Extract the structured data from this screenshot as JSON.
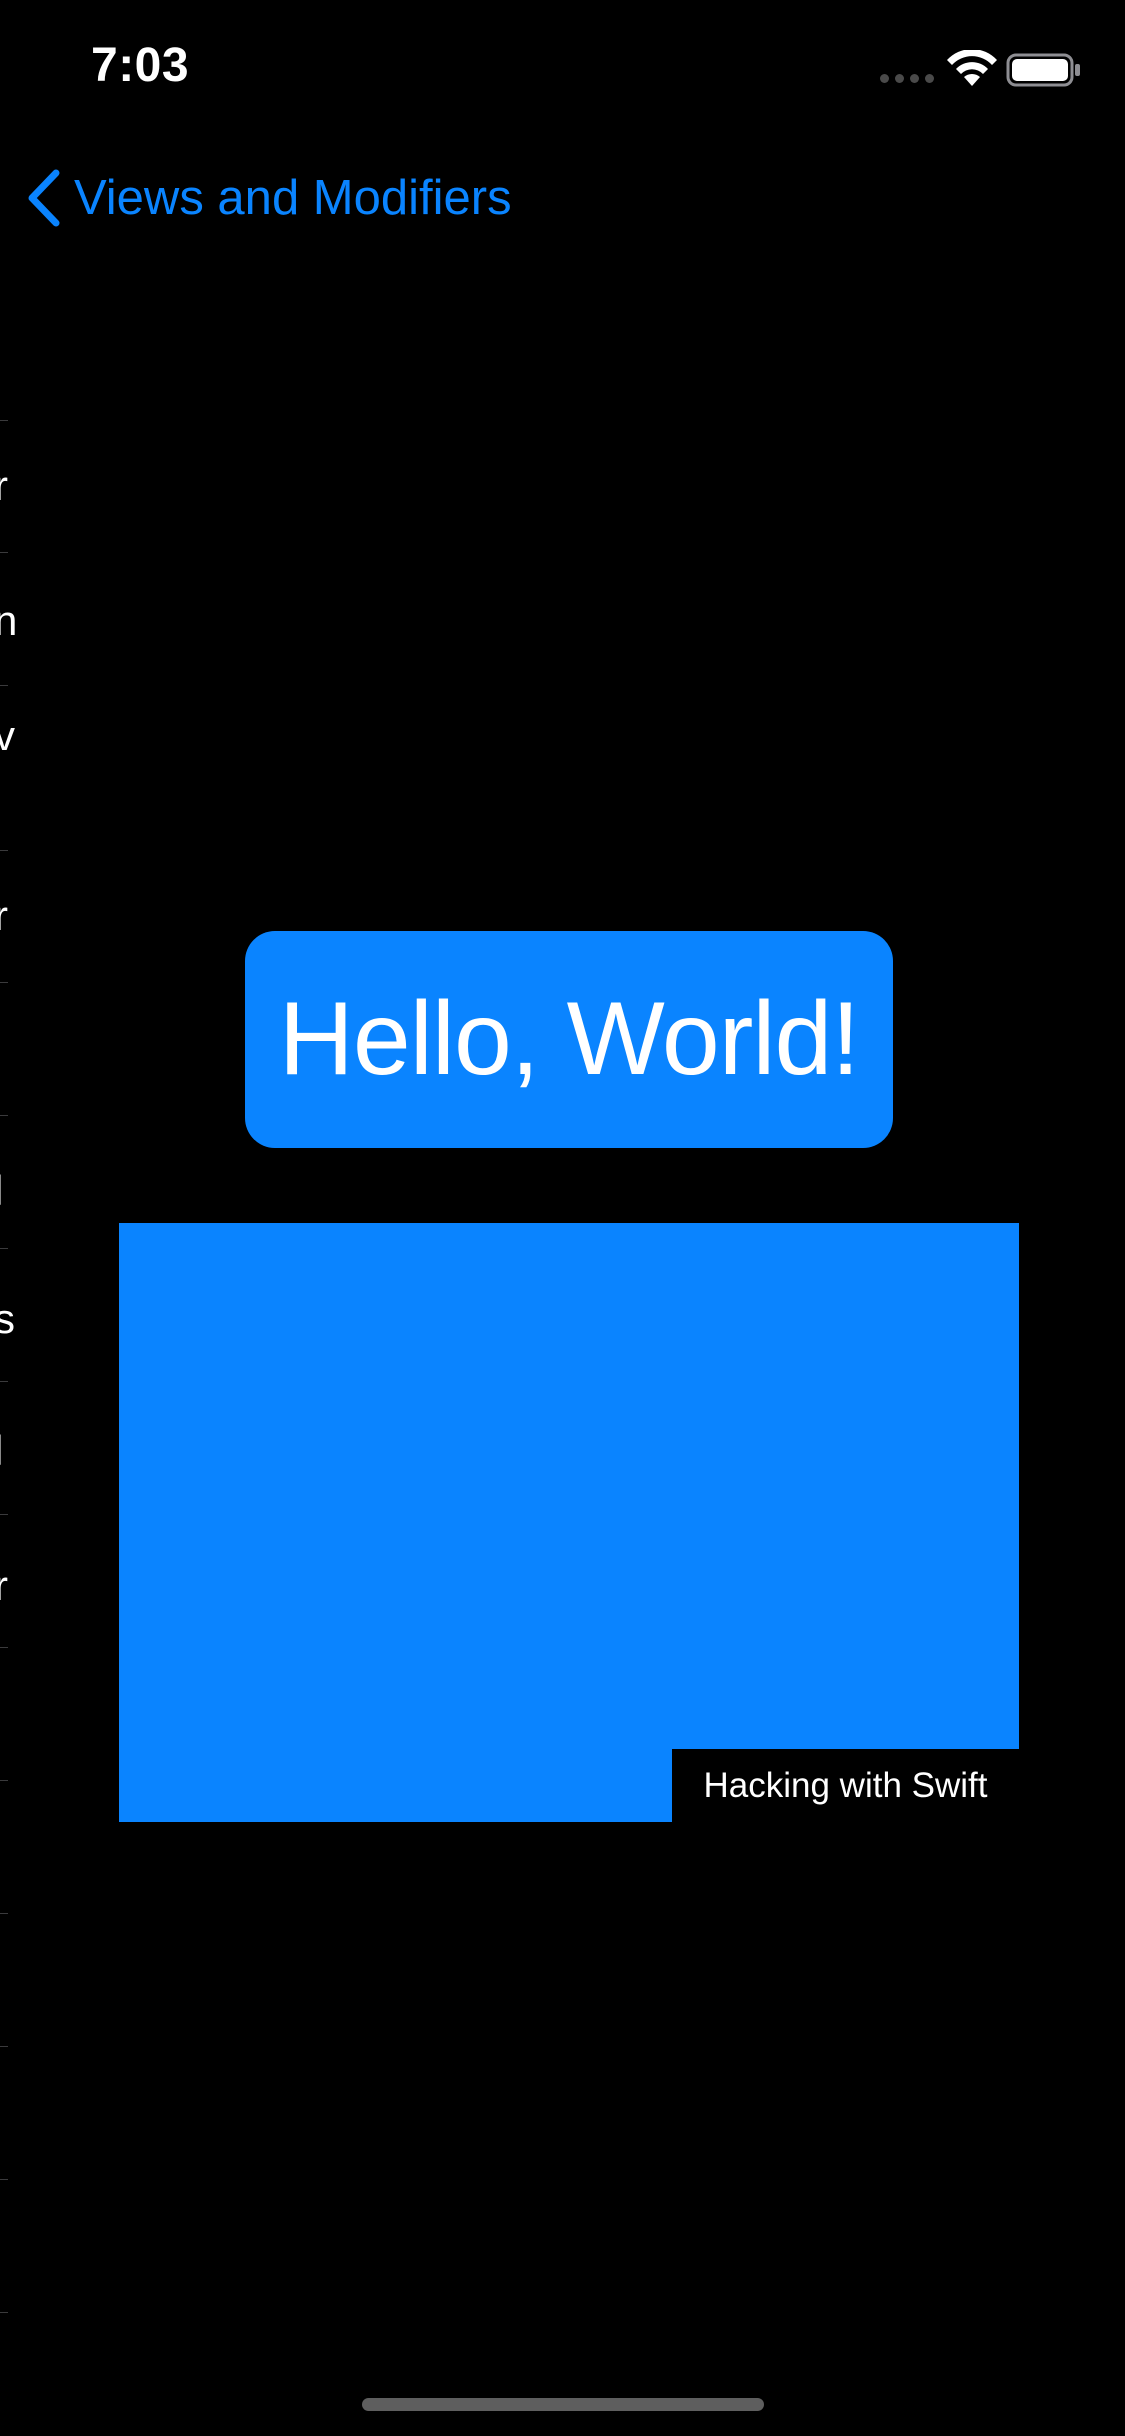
{
  "status_bar": {
    "time": "7:03",
    "wifi_icon": "wifi-icon",
    "battery_icon": "battery-icon",
    "signal_icon": "cellular-signal-icon"
  },
  "nav": {
    "back_label": "Views and Modifiers",
    "back_icon": "chevron-left-icon",
    "accent_color": "#0a84ff"
  },
  "background_list": {
    "fragments": [
      "r",
      "n",
      "v",
      "r",
      "l",
      "s",
      "l",
      "r"
    ]
  },
  "content": {
    "hello_text": "Hello, World!",
    "rect_caption": "Hacking with Swift",
    "fill_color": "#0a84ff",
    "background_color": "#000000"
  }
}
